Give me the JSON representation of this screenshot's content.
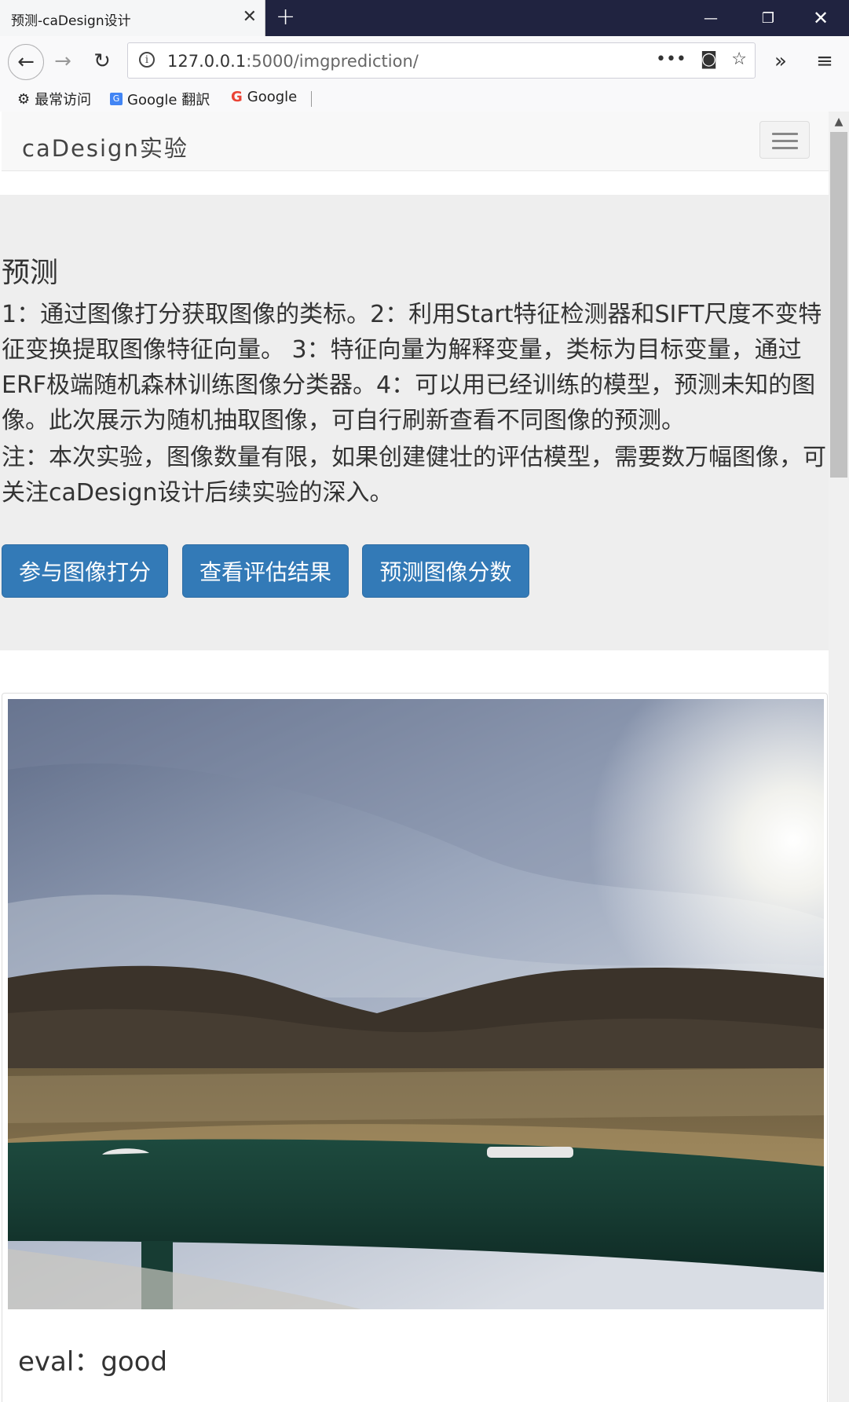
{
  "browser": {
    "tab_title": "预测-caDesign设计",
    "url_host": "127.0.0.1",
    "url_rest": ":5000/imgprediction/",
    "bookmarks": [
      "最常访问",
      "Google 翻訳",
      "Google"
    ]
  },
  "site": {
    "brand": "caDesign实验",
    "heading": "预测",
    "description": "1：通过图像打分获取图像的类标。2：利用Start特征检测器和SIFT尺度不变特征变换提取图像特征向量。 3：特征向量为解释变量，类标为目标变量，通过ERF极端随机森林训练图像分类器。4：可以用已经训练的模型，预测未知的图像。此次展示为随机抽取图像，可自行刷新查看不同图像的预测。",
    "note": "注：本次实验，图像数量有限，如果创建健壮的评估模型，需要数万幅图像，可关注caDesign设计后续实验的深入。",
    "buttons": [
      "参与图像打分",
      "查看评估结果",
      "预测图像分数"
    ],
    "eval_label": "eval：",
    "eval_value": "good"
  }
}
